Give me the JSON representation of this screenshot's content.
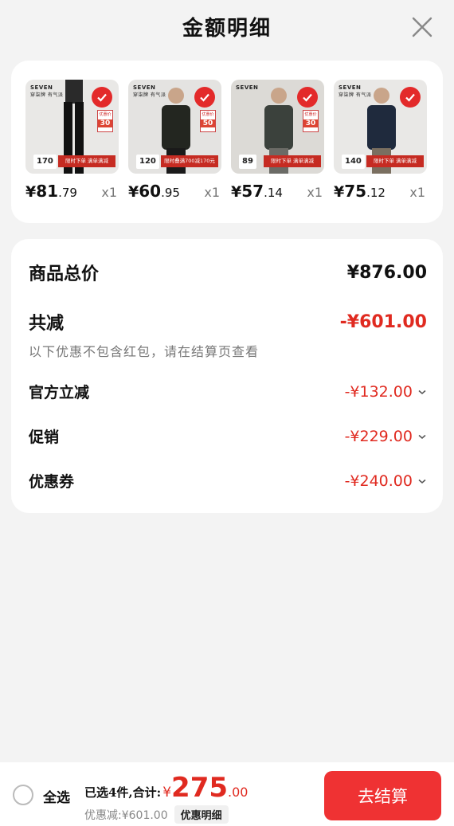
{
  "header": {
    "title": "金额明细"
  },
  "products": [
    {
      "brand": "SEVEN",
      "brand_sub": "穿柒牌 有气派",
      "tag_price": "170",
      "promo": "限时下单 满单满减",
      "mini_tag_top": "优惠价",
      "mini_tag_num": "30",
      "price_yen": "¥",
      "price_int": "81",
      "price_dec": ".79",
      "qty": "x1"
    },
    {
      "brand": "SEVEN",
      "brand_sub": "穿柒牌 有气派",
      "tag_price": "120",
      "promo": "限时叠满700减170元",
      "mini_tag_top": "优惠价",
      "mini_tag_num": "50",
      "price_yen": "¥",
      "price_int": "60",
      "price_dec": ".95",
      "qty": "x1"
    },
    {
      "brand": "SEVEN",
      "brand_sub": "",
      "tag_price": "89",
      "promo": "限时下单 满单满减",
      "mini_tag_top": "优惠价",
      "mini_tag_num": "30",
      "price_yen": "¥",
      "price_int": "57",
      "price_dec": ".14",
      "qty": "x1"
    },
    {
      "brand": "SEVEN",
      "brand_sub": "穿柒牌 有气派",
      "tag_price": "140",
      "promo": "限时下单 满单满减",
      "mini_tag_top": "",
      "mini_tag_num": "",
      "price_yen": "¥",
      "price_int": "75",
      "price_dec": ".12",
      "qty": "x1"
    }
  ],
  "summary": {
    "total_label": "商品总价",
    "total_value": "¥876.00",
    "reduce_label": "共减",
    "reduce_value": "-¥601.00",
    "note": "以下优惠不包含红包，请在结算页查看",
    "items": [
      {
        "label": "官方立减",
        "value": "-¥132.00"
      },
      {
        "label": "促销",
        "value": "-¥229.00"
      },
      {
        "label": "优惠券",
        "value": "-¥240.00"
      }
    ]
  },
  "bottom": {
    "select_all": "全选",
    "total_label": "已选4件,合计:",
    "total_yen": "¥",
    "total_int": "275",
    "total_dec": ".00",
    "discount_text": "优惠减:¥601.00",
    "detail_chip": "优惠明细",
    "checkout": "去结算"
  },
  "colors": {
    "accent": "#e02a20",
    "checkout_bg": "#ef3233"
  }
}
